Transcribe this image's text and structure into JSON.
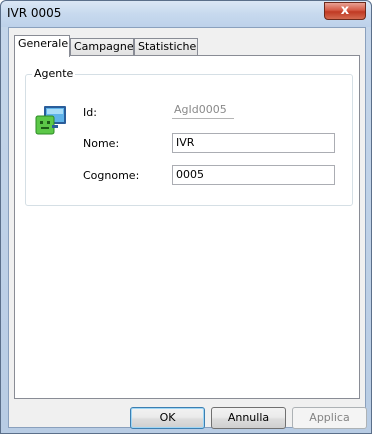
{
  "window": {
    "title": "IVR 0005",
    "close_glyph": "x"
  },
  "tabs": [
    {
      "label": "Generale",
      "active": true
    },
    {
      "label": "Campagne",
      "active": false
    },
    {
      "label": "Statistiche",
      "active": false
    }
  ],
  "agent_group": {
    "legend": "Agente",
    "icon": "agent-monitor-icon",
    "fields": {
      "id": {
        "label": "Id:",
        "value": "AgId0005"
      },
      "nome": {
        "label": "Nome:",
        "value": "IVR"
      },
      "cognome": {
        "label": "Cognome:",
        "value": "0005"
      }
    }
  },
  "buttons": {
    "ok": "OK",
    "cancel": "Annulla",
    "apply": "Applica"
  }
}
